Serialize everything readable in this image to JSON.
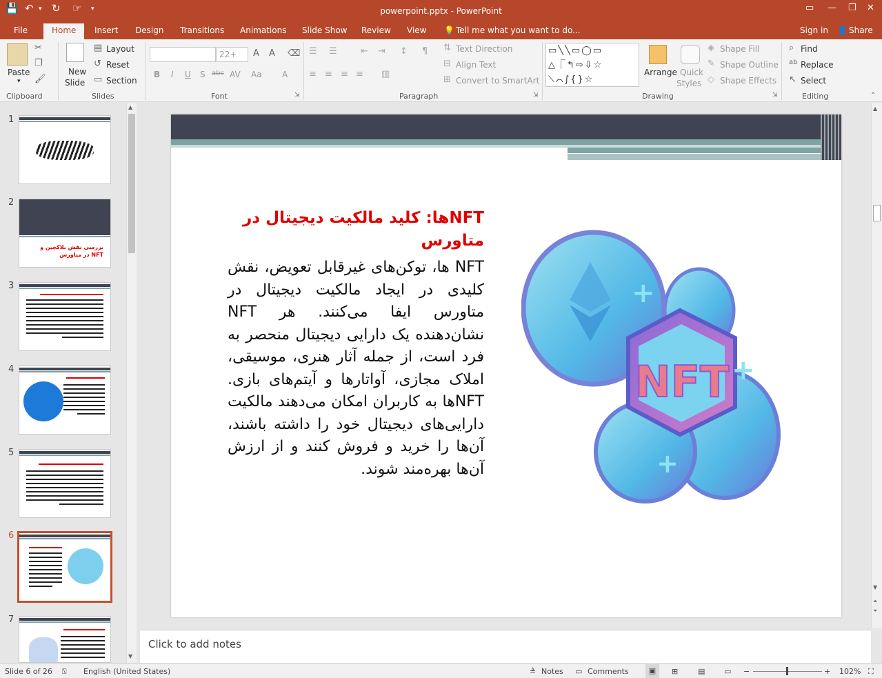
{
  "app": {
    "doc_title": "powerpoint.pptx - PowerPoint"
  },
  "qat": {
    "save": "save-icon",
    "undo": "undo-icon",
    "redo": "redo-icon",
    "touch": "touch-mode-icon",
    "customize": "customize-icon"
  },
  "tabs": [
    "File",
    "Home",
    "Insert",
    "Design",
    "Transitions",
    "Animations",
    "Slide Show",
    "Review",
    "View"
  ],
  "tell_me": "Tell me what you want to do...",
  "account": {
    "sign_in": "Sign in",
    "share": "Share"
  },
  "ribbon": {
    "clipboard": {
      "paste": "Paste",
      "group": "Clipboard"
    },
    "slides": {
      "new_slide_1": "New",
      "new_slide_2": "Slide",
      "layout": "Layout",
      "reset": "Reset",
      "section": "Section",
      "group": "Slides"
    },
    "font": {
      "font_name": "",
      "font_size": "22+",
      "bold": "B",
      "italic": "I",
      "underline": "U",
      "shadow": "S",
      "strike": "abc",
      "spacing": "AV",
      "case": "Aa",
      "color": "A",
      "group": "Font"
    },
    "paragraph": {
      "text_direction": "Text Direction",
      "align_text": "Align Text",
      "convert_smartart": "Convert to SmartArt",
      "group": "Paragraph"
    },
    "drawing": {
      "arrange": "Arrange",
      "quick_styles_1": "Quick",
      "quick_styles_2": "Styles",
      "shape_fill": "Shape Fill",
      "shape_outline": "Shape Outline",
      "shape_effects": "Shape Effects",
      "group": "Drawing"
    },
    "editing": {
      "find": "Find",
      "replace": "Replace",
      "select": "Select",
      "group": "Editing"
    }
  },
  "thumbnails": [
    {
      "num": "1"
    },
    {
      "num": "2",
      "text": "بررسی نقش بلاکچین و NFT در متاورس"
    },
    {
      "num": "3"
    },
    {
      "num": "4"
    },
    {
      "num": "5"
    },
    {
      "num": "6"
    },
    {
      "num": "7"
    }
  ],
  "slide": {
    "title": "NFTها: کلید مالکیت دیجیتال در متاورس",
    "body": "NFT ها، توکن‌های غیرقابل تعویض، نقش کلیدی در ایجاد مالکیت دیجیتال در متاورس ایفا می‌کنند. هر NFT نشان‌دهنده یک دارایی دیجیتال منحصر به فرد است، از جمله آثار هنری، موسیقی، املاک مجازی، آواتارها و آیتم‌های بازی. NFTها به کاربران امکان می‌دهند مالکیت دارایی‌های دیجیتال خود را داشته باشند، آن‌ها را خرید و فروش کنند و از ارزش آن‌ها بهره‌مند شوند.",
    "image_text": "NFT"
  },
  "notes_placeholder": "Click to add notes",
  "status": {
    "slide_info": "Slide 6 of 26",
    "language": "English (United States)",
    "notes": "Notes",
    "comments": "Comments",
    "zoom": "102%"
  },
  "colors": {
    "accent": "#b7472a",
    "slide_title": "#e00000",
    "slide_dark_band": "#3f4352",
    "slide_teal": "#7fa3a3"
  }
}
